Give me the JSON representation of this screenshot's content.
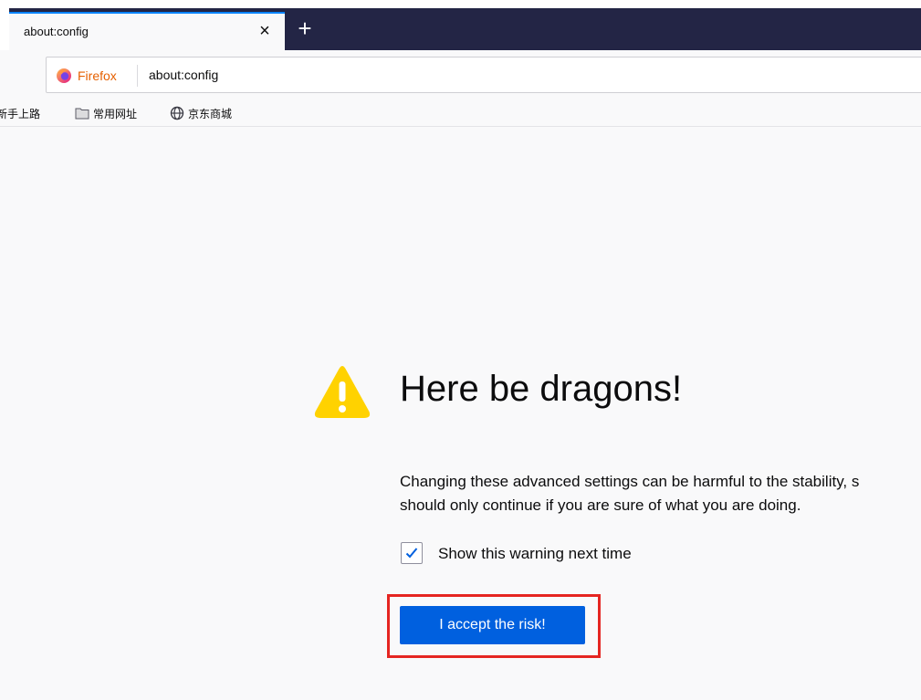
{
  "tab": {
    "title": "about:config",
    "close_glyph": "×",
    "new_tab_glyph": "+"
  },
  "urlbar": {
    "identity_label": "Firefox",
    "identity_icon": "firefox-logo-icon",
    "url": "about:config"
  },
  "bookmarks": {
    "items": [
      {
        "label": "新手上路",
        "icon": "none"
      },
      {
        "label": "常用网址",
        "icon": "folder-icon"
      },
      {
        "label": "京东商城",
        "icon": "globe-icon"
      }
    ]
  },
  "warning": {
    "icon": "warning-triangle-icon",
    "heading": "Here be dragons!",
    "description_line1": "Changing these advanced settings can be harmful to the stability, s",
    "description_line2": "should only continue if you are sure of what you are doing.",
    "checkbox_label": "Show this warning next time",
    "checkbox_checked": true,
    "accept_button": "I accept the risk!"
  },
  "colors": {
    "tabbar": "#232545",
    "tab_active_border": "#0a84ff",
    "page_background": "#f9f9fa",
    "accept_button": "#0060df",
    "warning_icon": "#ffd200",
    "highlight_box": "#e52521",
    "firefox_orange": "#e66000"
  }
}
